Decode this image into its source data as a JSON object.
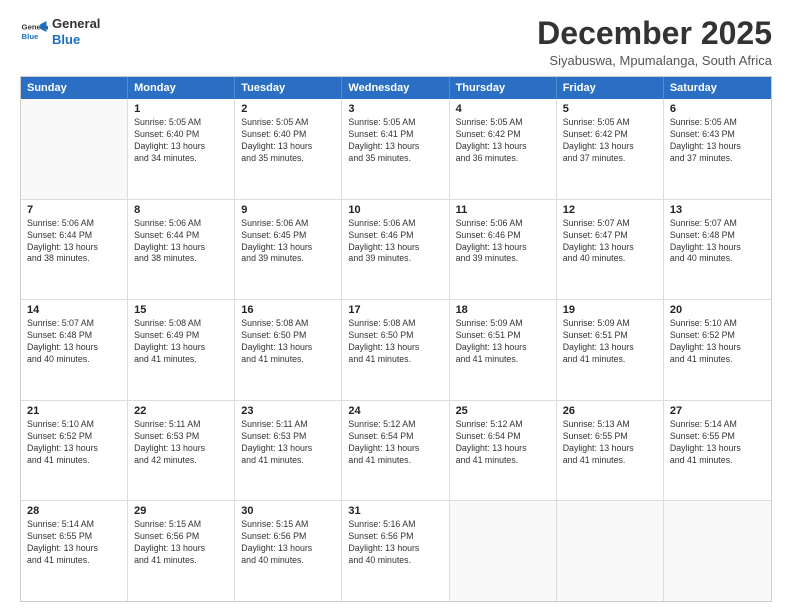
{
  "logo": {
    "line1": "General",
    "line2": "Blue"
  },
  "title": "December 2025",
  "location": "Siyabuswa, Mpumalanga, South Africa",
  "days_header": [
    "Sunday",
    "Monday",
    "Tuesday",
    "Wednesday",
    "Thursday",
    "Friday",
    "Saturday"
  ],
  "weeks": [
    [
      {
        "day": "",
        "info": ""
      },
      {
        "day": "1",
        "info": "Sunrise: 5:05 AM\nSunset: 6:40 PM\nDaylight: 13 hours\nand 34 minutes."
      },
      {
        "day": "2",
        "info": "Sunrise: 5:05 AM\nSunset: 6:40 PM\nDaylight: 13 hours\nand 35 minutes."
      },
      {
        "day": "3",
        "info": "Sunrise: 5:05 AM\nSunset: 6:41 PM\nDaylight: 13 hours\nand 35 minutes."
      },
      {
        "day": "4",
        "info": "Sunrise: 5:05 AM\nSunset: 6:42 PM\nDaylight: 13 hours\nand 36 minutes."
      },
      {
        "day": "5",
        "info": "Sunrise: 5:05 AM\nSunset: 6:42 PM\nDaylight: 13 hours\nand 37 minutes."
      },
      {
        "day": "6",
        "info": "Sunrise: 5:05 AM\nSunset: 6:43 PM\nDaylight: 13 hours\nand 37 minutes."
      }
    ],
    [
      {
        "day": "7",
        "info": "Sunrise: 5:06 AM\nSunset: 6:44 PM\nDaylight: 13 hours\nand 38 minutes."
      },
      {
        "day": "8",
        "info": "Sunrise: 5:06 AM\nSunset: 6:44 PM\nDaylight: 13 hours\nand 38 minutes."
      },
      {
        "day": "9",
        "info": "Sunrise: 5:06 AM\nSunset: 6:45 PM\nDaylight: 13 hours\nand 39 minutes."
      },
      {
        "day": "10",
        "info": "Sunrise: 5:06 AM\nSunset: 6:46 PM\nDaylight: 13 hours\nand 39 minutes."
      },
      {
        "day": "11",
        "info": "Sunrise: 5:06 AM\nSunset: 6:46 PM\nDaylight: 13 hours\nand 39 minutes."
      },
      {
        "day": "12",
        "info": "Sunrise: 5:07 AM\nSunset: 6:47 PM\nDaylight: 13 hours\nand 40 minutes."
      },
      {
        "day": "13",
        "info": "Sunrise: 5:07 AM\nSunset: 6:48 PM\nDaylight: 13 hours\nand 40 minutes."
      }
    ],
    [
      {
        "day": "14",
        "info": "Sunrise: 5:07 AM\nSunset: 6:48 PM\nDaylight: 13 hours\nand 40 minutes."
      },
      {
        "day": "15",
        "info": "Sunrise: 5:08 AM\nSunset: 6:49 PM\nDaylight: 13 hours\nand 41 minutes."
      },
      {
        "day": "16",
        "info": "Sunrise: 5:08 AM\nSunset: 6:50 PM\nDaylight: 13 hours\nand 41 minutes."
      },
      {
        "day": "17",
        "info": "Sunrise: 5:08 AM\nSunset: 6:50 PM\nDaylight: 13 hours\nand 41 minutes."
      },
      {
        "day": "18",
        "info": "Sunrise: 5:09 AM\nSunset: 6:51 PM\nDaylight: 13 hours\nand 41 minutes."
      },
      {
        "day": "19",
        "info": "Sunrise: 5:09 AM\nSunset: 6:51 PM\nDaylight: 13 hours\nand 41 minutes."
      },
      {
        "day": "20",
        "info": "Sunrise: 5:10 AM\nSunset: 6:52 PM\nDaylight: 13 hours\nand 41 minutes."
      }
    ],
    [
      {
        "day": "21",
        "info": "Sunrise: 5:10 AM\nSunset: 6:52 PM\nDaylight: 13 hours\nand 41 minutes."
      },
      {
        "day": "22",
        "info": "Sunrise: 5:11 AM\nSunset: 6:53 PM\nDaylight: 13 hours\nand 42 minutes."
      },
      {
        "day": "23",
        "info": "Sunrise: 5:11 AM\nSunset: 6:53 PM\nDaylight: 13 hours\nand 41 minutes."
      },
      {
        "day": "24",
        "info": "Sunrise: 5:12 AM\nSunset: 6:54 PM\nDaylight: 13 hours\nand 41 minutes."
      },
      {
        "day": "25",
        "info": "Sunrise: 5:12 AM\nSunset: 6:54 PM\nDaylight: 13 hours\nand 41 minutes."
      },
      {
        "day": "26",
        "info": "Sunrise: 5:13 AM\nSunset: 6:55 PM\nDaylight: 13 hours\nand 41 minutes."
      },
      {
        "day": "27",
        "info": "Sunrise: 5:14 AM\nSunset: 6:55 PM\nDaylight: 13 hours\nand 41 minutes."
      }
    ],
    [
      {
        "day": "28",
        "info": "Sunrise: 5:14 AM\nSunset: 6:55 PM\nDaylight: 13 hours\nand 41 minutes."
      },
      {
        "day": "29",
        "info": "Sunrise: 5:15 AM\nSunset: 6:56 PM\nDaylight: 13 hours\nand 41 minutes."
      },
      {
        "day": "30",
        "info": "Sunrise: 5:15 AM\nSunset: 6:56 PM\nDaylight: 13 hours\nand 40 minutes."
      },
      {
        "day": "31",
        "info": "Sunrise: 5:16 AM\nSunset: 6:56 PM\nDaylight: 13 hours\nand 40 minutes."
      },
      {
        "day": "",
        "info": ""
      },
      {
        "day": "",
        "info": ""
      },
      {
        "day": "",
        "info": ""
      }
    ]
  ]
}
